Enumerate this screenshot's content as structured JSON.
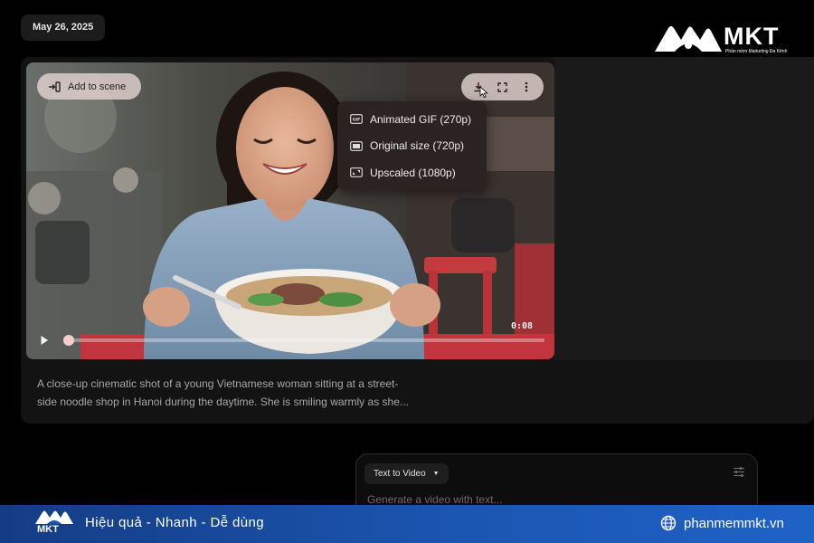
{
  "date": "May 26, 2025",
  "brand": {
    "logo_text": "MKT",
    "tagline": "Phần mềm Marketing Đa Kênh"
  },
  "video": {
    "add_to_scene_label": "Add to scene",
    "duration": "0:08",
    "progress": 0.0
  },
  "download_menu": {
    "items": [
      {
        "label": "Animated GIF (270p)",
        "icon": "gif-icon"
      },
      {
        "label": "Original size (720p)",
        "icon": "rectangle-icon"
      },
      {
        "label": "Upscaled (1080p)",
        "icon": "upscale-icon"
      }
    ]
  },
  "description": "A close-up cinematic shot of a young Vietnamese woman sitting at a street-side noodle shop in Hanoi during the daytime. She is smiling warmly as she...",
  "composer": {
    "mode_label": "Text to Video",
    "placeholder": "Generate a video with text..."
  },
  "banner": {
    "slogan": "Hiệu quả - Nhanh - Dễ dùng",
    "website": "phanmemmkt.vn"
  },
  "colors": {
    "banner": "#1b55b0",
    "menu_bg": "#2a2322",
    "pill_bg": "#e2d2ce"
  }
}
